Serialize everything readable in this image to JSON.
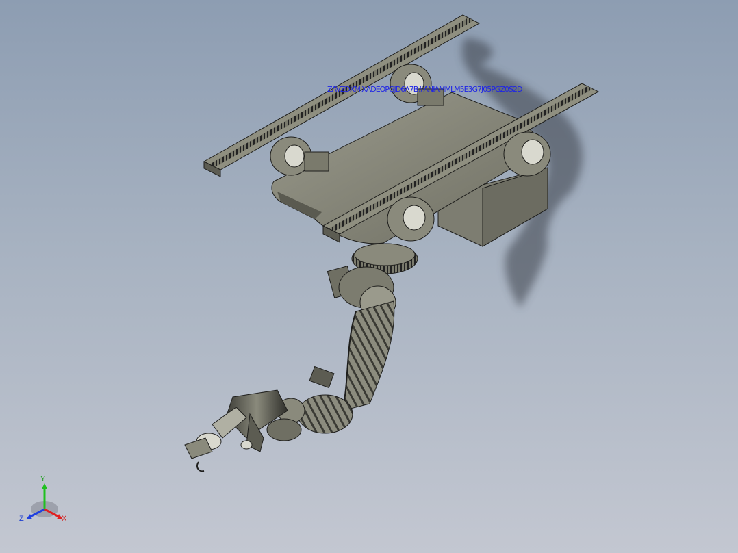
{
  "viewport": {
    "overlay_text": "ZAVZDXMIXADEOPGJD6A7B#ANIAMMLM5E3G7J05PGZ0S2D",
    "axes": {
      "x": "X",
      "y": "Y",
      "z": "Z"
    }
  },
  "colors": {
    "background_top": "#8d9db2",
    "background_bottom": "#c3c7d1",
    "model_fill": "#8a8a7c",
    "model_edge": "#1e1e1c",
    "overlay_text": "#1f25e6",
    "axis_x": "#e02020",
    "axis_y": "#20c020",
    "axis_z": "#2040e0"
  }
}
